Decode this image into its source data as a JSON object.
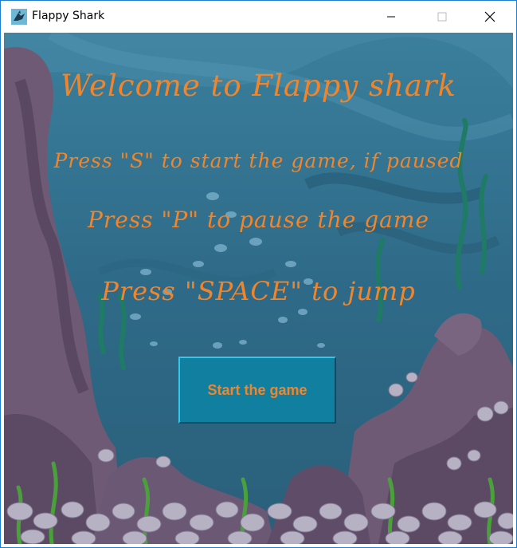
{
  "window": {
    "title": "Flappy Shark",
    "icon": "shark-app-icon",
    "controls": [
      "minimize-icon",
      "maximize-icon",
      "close-icon"
    ]
  },
  "menu": {
    "welcome": "Welcome to Flappy shark",
    "instructions": [
      "Press \"S\" to start the game, if paused",
      "Press \"P\" to pause the game",
      "Press \"SPACE\" to jump"
    ],
    "start_button": "Start the game"
  },
  "colors": {
    "text_accent": "#f2852a",
    "button_bg": "#1180a0",
    "water": "#2f6f8d",
    "rock": "#6e5a74"
  }
}
